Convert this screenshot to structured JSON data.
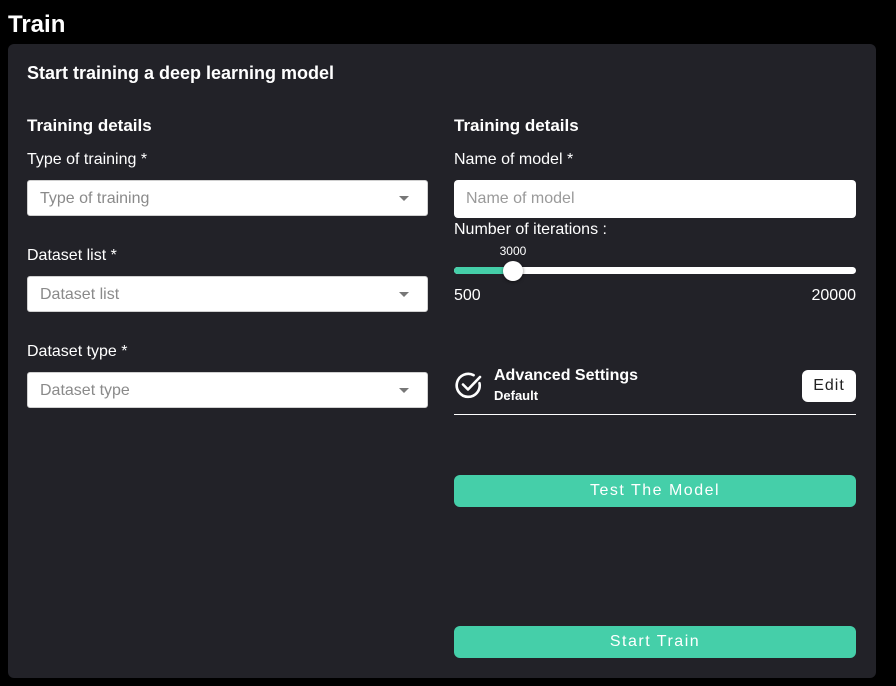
{
  "page": {
    "title": "Train"
  },
  "panel": {
    "heading": "Start training a deep learning model"
  },
  "left": {
    "section_heading": "Training details",
    "fields": [
      {
        "label": "Type of training  *",
        "placeholder": "Type of training"
      },
      {
        "label": "Dataset list  *",
        "placeholder": "Dataset list"
      },
      {
        "label": "Dataset type  *",
        "placeholder": "Dataset type"
      }
    ]
  },
  "right": {
    "section_heading": "Training details",
    "model_name": {
      "label": "Name of model *",
      "placeholder": "Name of model",
      "value": ""
    },
    "iterations": {
      "label": "Number of iterations :",
      "value": 3000,
      "value_label": "3000",
      "min": 500,
      "max": 20000,
      "min_label": "500",
      "max_label": "20000"
    },
    "advanced": {
      "title": "Advanced Settings",
      "subtitle": "Default",
      "icon": "check-circle-icon",
      "edit_label": "Edit"
    },
    "test_button_label": "Test The Model",
    "start_button_label": "Start Train"
  },
  "colors": {
    "background": "#000000",
    "panel": "#222228",
    "accent": "#45cfa9",
    "text": "#ffffff"
  }
}
